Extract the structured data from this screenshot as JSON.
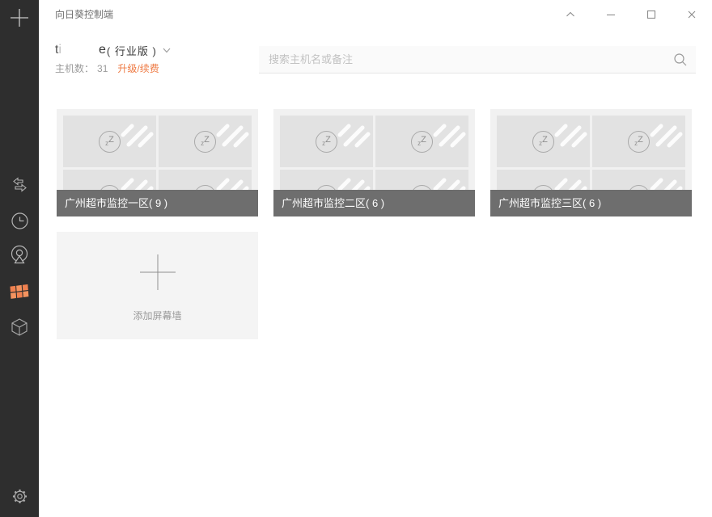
{
  "colors": {
    "accent_orange": "#ee7942",
    "sidebar_bg": "#2e2e2e",
    "card_bg": "#f1f1f1",
    "thumbnail_bg": "#e2e2e2",
    "card_label_bg": "#6e6e6e"
  },
  "window": {
    "title": "向日葵控制端",
    "controls": [
      {
        "id": "collapse",
        "icon": "chevron-up-icon"
      },
      {
        "id": "minimize",
        "icon": "minimize-icon"
      },
      {
        "id": "maximize",
        "icon": "maximize-icon"
      },
      {
        "id": "close",
        "icon": "close-icon"
      }
    ]
  },
  "sidebar": {
    "items": [
      {
        "id": "add",
        "icon": "plus-icon"
      },
      {
        "id": "remote-control",
        "icon": "swap-arrows-icon"
      },
      {
        "id": "history",
        "icon": "clock-icon"
      },
      {
        "id": "camera",
        "icon": "camera-icon"
      },
      {
        "id": "screen-wall",
        "icon": "screen-wall-grid-icon",
        "active": true
      },
      {
        "id": "devices",
        "icon": "cube-icon"
      },
      {
        "id": "settings",
        "icon": "gear-icon"
      }
    ]
  },
  "account": {
    "username_prefix": "ti",
    "username_masked": true,
    "username_suffix": "e",
    "edition": "( 行业版 )",
    "hosts_label": "主机数：",
    "hosts_count": "31",
    "upgrade_label": "升级/续费"
  },
  "search": {
    "placeholder": "搜索主机名或备注"
  },
  "screen_walls": {
    "cards": [
      {
        "title": "广州超市监控一区( 9 )",
        "count": 9
      },
      {
        "title": "广州超市监控二区( 6 )",
        "count": 6
      },
      {
        "title": "广州超市监控三区( 6 )",
        "count": 6
      }
    ],
    "add_label": "添加屏幕墙",
    "sleep_small": "z",
    "sleep_big": "Z"
  }
}
